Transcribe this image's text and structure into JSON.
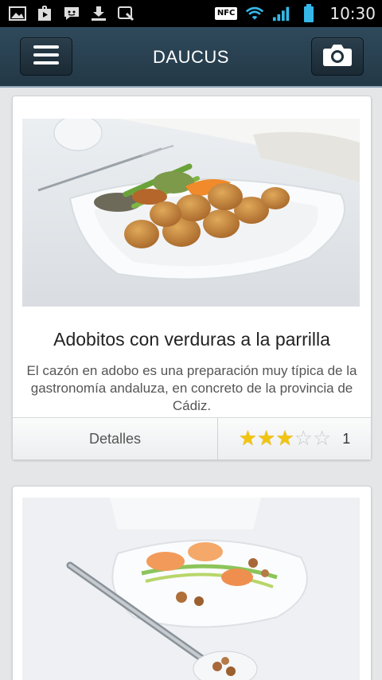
{
  "status_bar": {
    "time": "10:30",
    "nfc_label": "NFC",
    "icons_left": [
      "gallery-icon",
      "play-store-icon",
      "messenger-icon",
      "download-icon",
      "screenshot-icon"
    ],
    "icons_right": [
      "nfc-icon",
      "wifi-icon",
      "signal-icon",
      "battery-icon"
    ]
  },
  "app_bar": {
    "title": "DAUCUS",
    "menu_icon": "hamburger-menu-icon",
    "camera_icon": "camera-icon"
  },
  "recipes": [
    {
      "title": "Adobitos con verduras a la parrilla",
      "description": "El cazón en adobo es una preparación muy típica de la gastronomía andaluza, en concreto de la provincia de Cádiz.",
      "details_label": "Detalles",
      "rating": 3,
      "max_rating": 5,
      "rating_count": "1"
    }
  ],
  "colors": {
    "app_bar": "#2a4252",
    "background": "#e4e6e8",
    "star": "#f1c40f"
  }
}
